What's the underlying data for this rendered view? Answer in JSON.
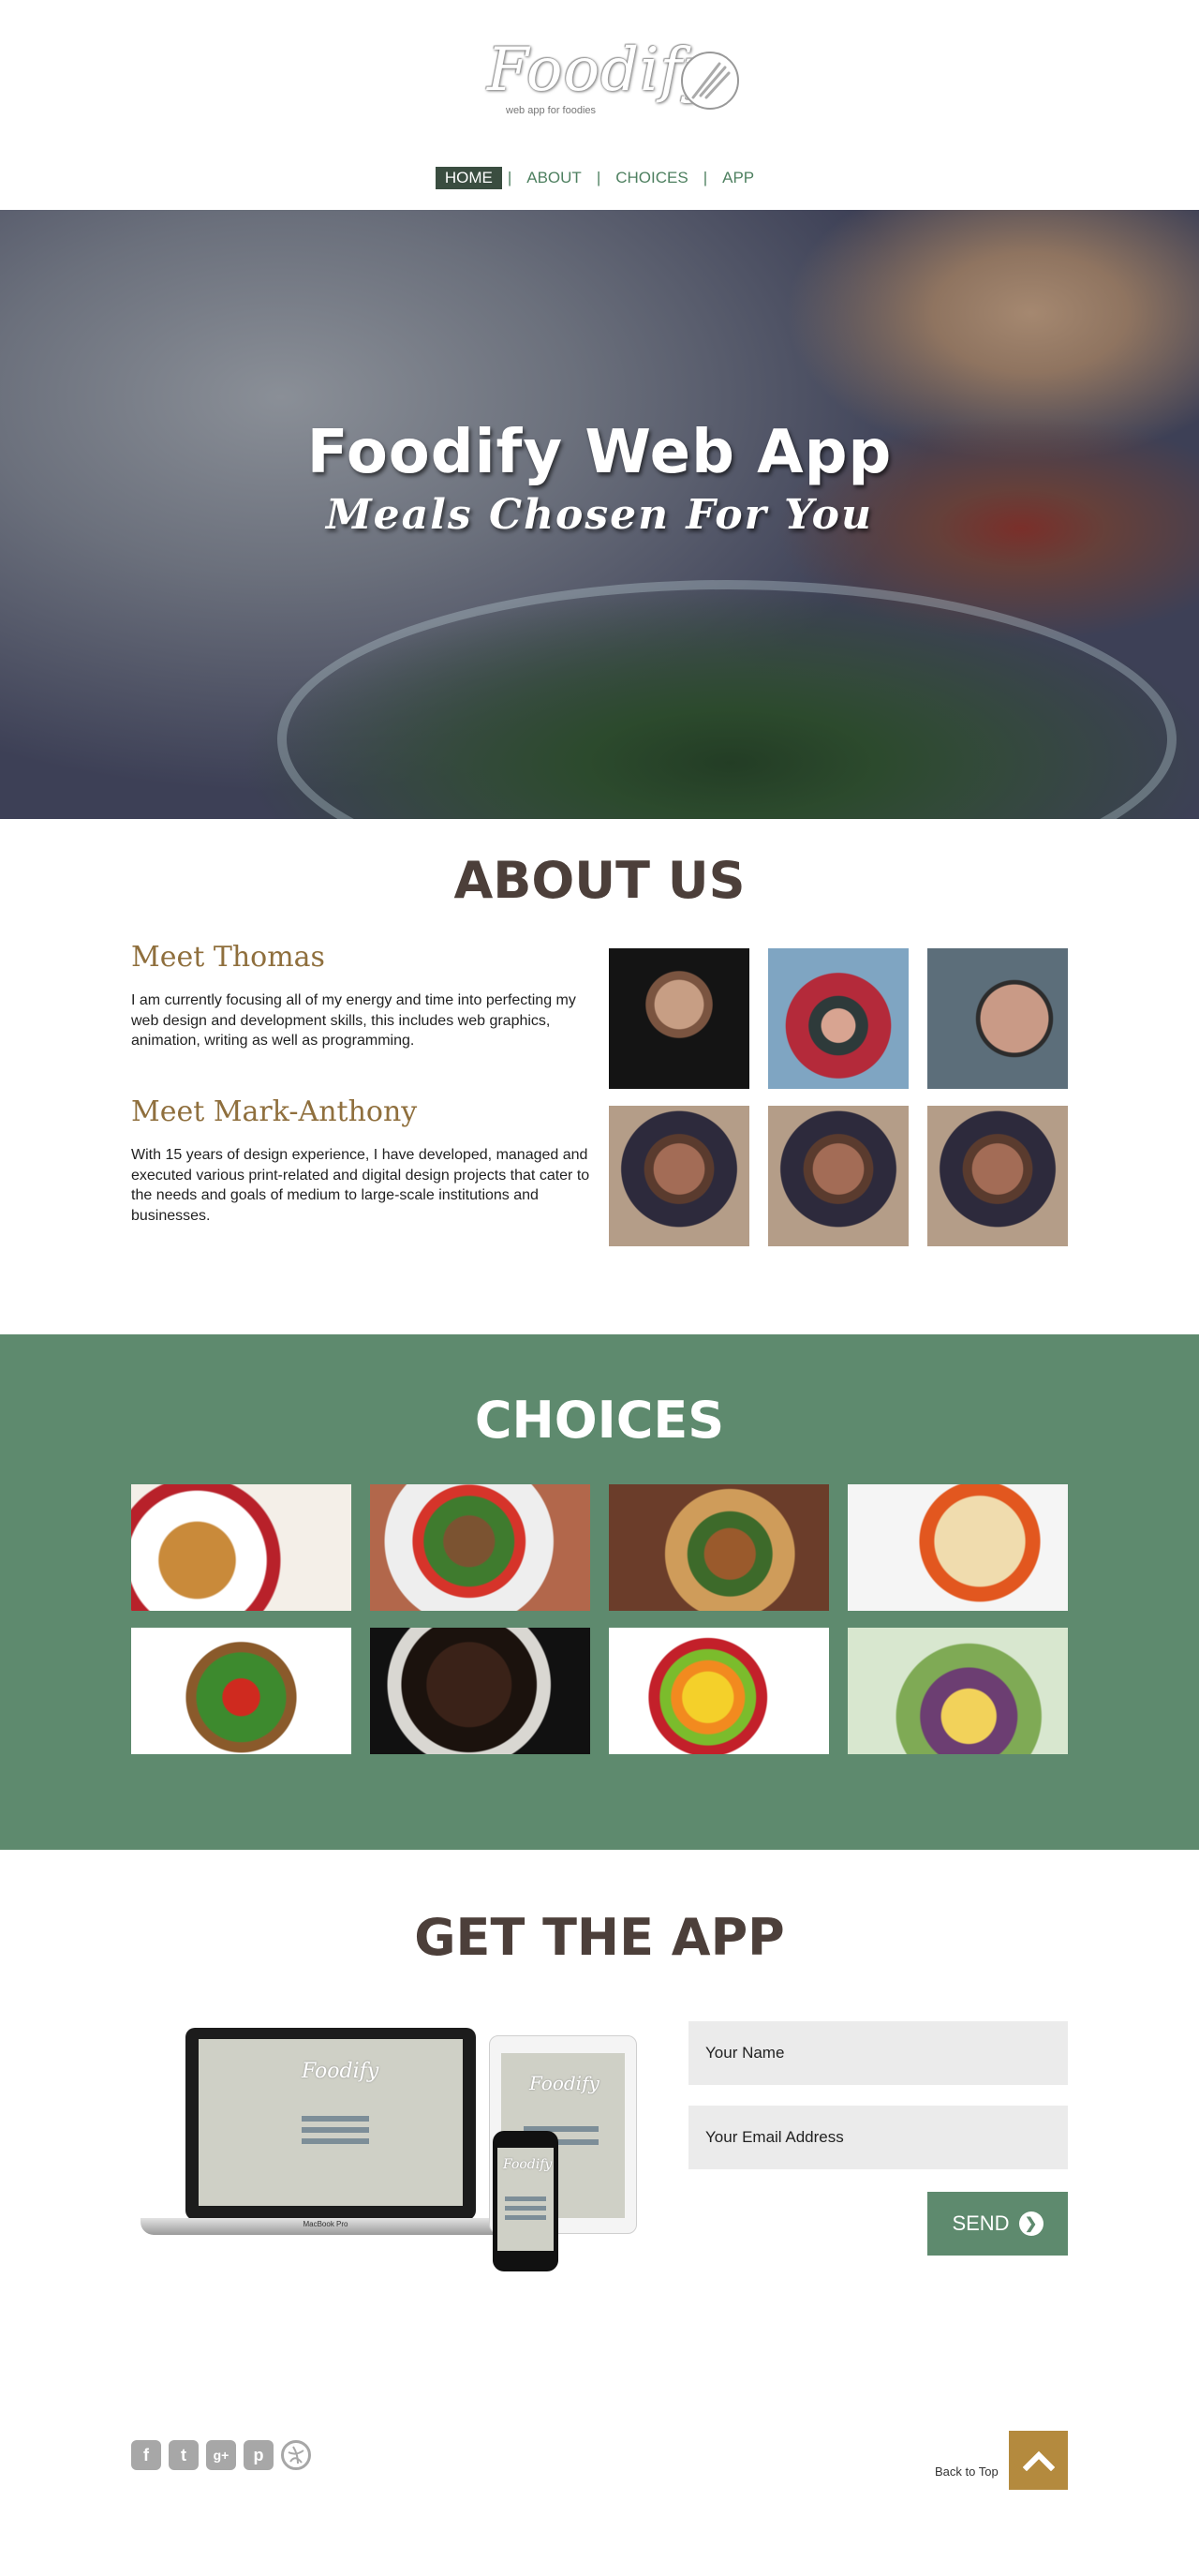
{
  "header": {
    "logo_text": "Foodify",
    "logo_tagline": "web app for foodies",
    "nav": [
      {
        "label": "HOME",
        "active": true
      },
      {
        "label": "ABOUT"
      },
      {
        "label": "CHOICES"
      },
      {
        "label": "APP"
      }
    ],
    "nav_separator": "|"
  },
  "hero": {
    "title": "Foodify Web App",
    "subtitle": "Meals Chosen For You"
  },
  "about": {
    "title": "ABOUT US",
    "people": [
      {
        "heading": "Meet Thomas",
        "text": "I am currently focusing all of my energy and time into perfecting my web design and development skills, this includes web graphics, animation, writing as well as programming."
      },
      {
        "heading": "Meet Mark-Anthony",
        "text": "With 15 years of design experience, I have developed, managed and executed various print-related and digital design projects that cater to the needs and goals of medium to large-scale institutions and businesses."
      }
    ]
  },
  "choices": {
    "title": "CHOICES"
  },
  "app": {
    "title": "GET THE APP",
    "laptop_label": "MacBook Pro",
    "name_placeholder": "Your Name",
    "email_placeholder": "Your Email Address",
    "send_label": "SEND"
  },
  "footer": {
    "back_to_top": "Back to Top",
    "social_icons": [
      "facebook-icon",
      "twitter-icon",
      "google-plus-icon",
      "pinterest-icon",
      "dribbble-icon"
    ]
  },
  "colors": {
    "accent_green": "#5e8a6e",
    "heading_brown": "#4c3f3a",
    "name_gold": "#8f6f3d",
    "back_button": "#b48a3e",
    "nav_active_bg": "#3a4d40"
  }
}
